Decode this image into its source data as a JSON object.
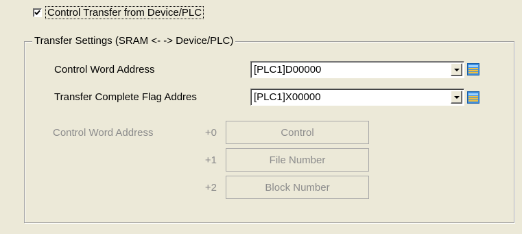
{
  "control_transfer": {
    "checked": true,
    "label": "Control Transfer from Device/PLC"
  },
  "transfer_settings": {
    "legend": "Transfer Settings (SRAM <- -> Device/PLC)",
    "control_word": {
      "label": "Control Word Address",
      "value": "[PLC1]D00000",
      "browse_icon": "address-book-icon"
    },
    "complete_flag": {
      "label": "Transfer Complete Flag Addres",
      "value": "[PLC1]X00000",
      "browse_icon": "address-book-icon"
    },
    "word_map": {
      "label": "Control Word Address",
      "rows": [
        {
          "offset": "+0",
          "name": "Control"
        },
        {
          "offset": "+1",
          "name": "File Number"
        },
        {
          "offset": "+2",
          "name": "Block Number"
        }
      ]
    }
  }
}
